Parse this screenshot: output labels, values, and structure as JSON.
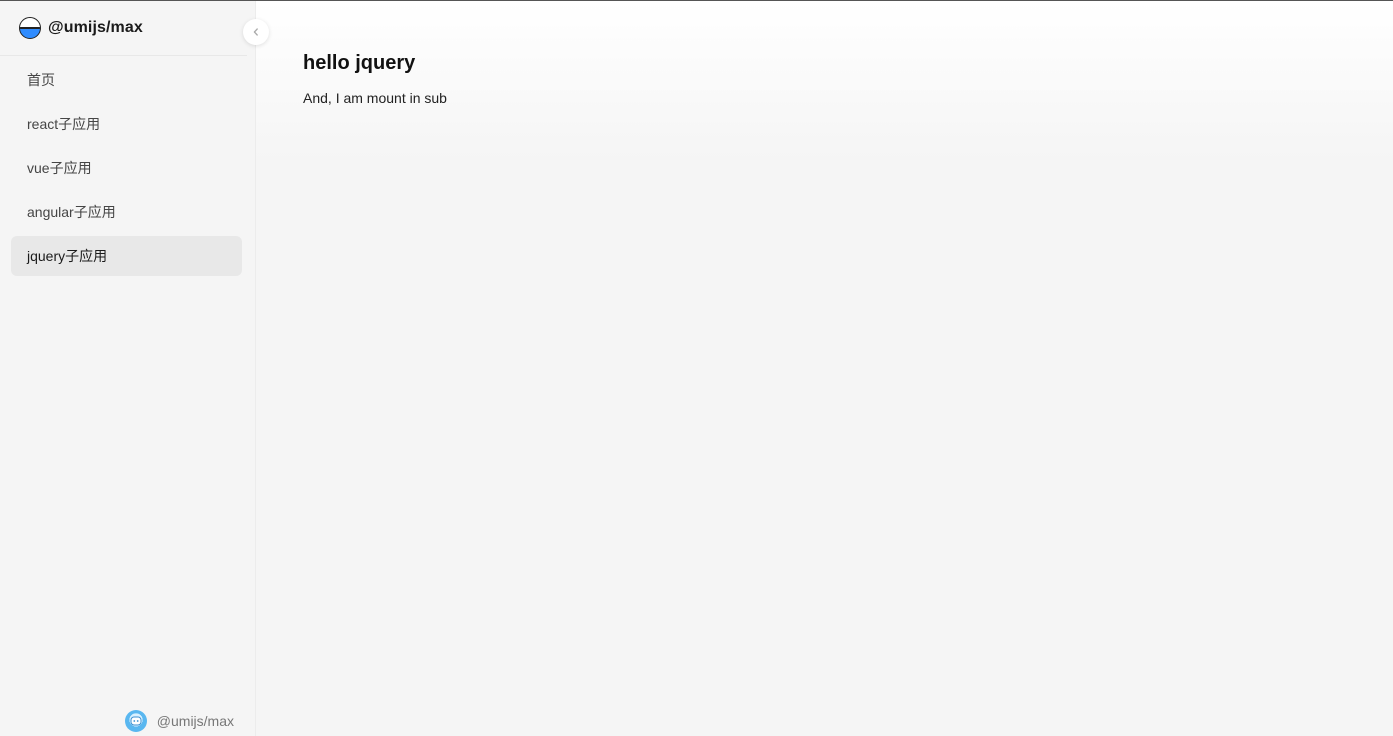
{
  "brand": {
    "title": "@umijs/max"
  },
  "menu": {
    "items": [
      {
        "label": "首页"
      },
      {
        "label": "react子应用"
      },
      {
        "label": "vue子应用"
      },
      {
        "label": "angular子应用"
      },
      {
        "label": "jquery子应用"
      }
    ],
    "active_index": 4
  },
  "footer": {
    "label": "@umijs/max"
  },
  "main": {
    "title": "hello jquery",
    "text": "And, I am mount in sub"
  },
  "icons": {
    "logo": "umi-logo-icon",
    "collapse": "chevron-left-icon",
    "footer_avatar": "umi-avatar-icon"
  },
  "colors": {
    "accent": "#2f8cff",
    "active_bg": "#e8e8e8"
  }
}
